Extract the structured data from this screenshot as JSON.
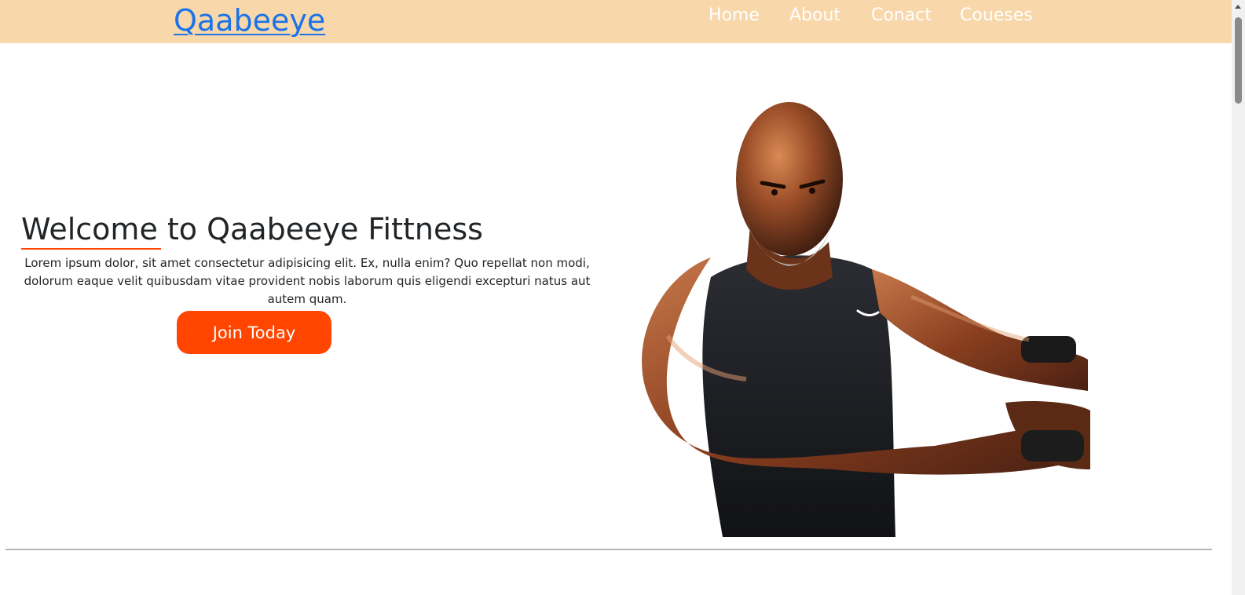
{
  "navbar": {
    "brand": "Qaabeeye",
    "links": [
      "Home",
      "About",
      "Conact",
      "Coueses"
    ],
    "background": "#f8d7aa",
    "brand_color": "#1a73e8"
  },
  "hero": {
    "title": "Welcome to Qaabeeye Fittness",
    "text": "Lorem ipsum dolor, sit amet consectetur adipisicing elit. Ex, nulla enim? Quo repellat non modi, dolorum eaque velit quibusdam vitae provident nobis laborum quis eligendi excepturi natus aut autem quam.",
    "button_label": "Join Today",
    "accent": "#ff4500"
  },
  "image": {
    "alt": "bodybuilder-photo"
  }
}
